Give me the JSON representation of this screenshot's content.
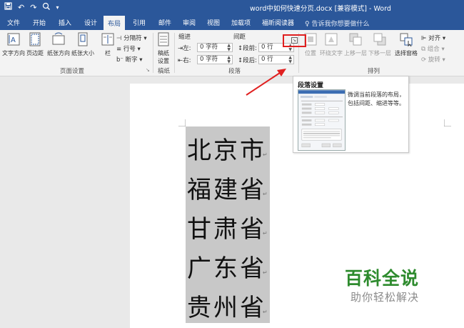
{
  "window": {
    "title": "word中如何快速分页.docx [兼容模式] - Word"
  },
  "tabs": [
    "文件",
    "开始",
    "插入",
    "设计",
    "布局",
    "引用",
    "邮件",
    "审阅",
    "视图",
    "加载项",
    "福昕阅读器"
  ],
  "active_tab": "布局",
  "tell_me": "告诉我你想要做什么",
  "ribbon": {
    "page_setup": {
      "text_direction": "文字方向",
      "margins": "页边距",
      "orientation": "纸张方向",
      "size": "纸张大小",
      "columns": "栏",
      "breaks": "分隔符",
      "line_numbers": "行号",
      "hyphenation": "断字",
      "group_label": "页面设置"
    },
    "draft": {
      "settings_l1": "稿纸",
      "settings_l2": "设置",
      "group_label": "稿纸"
    },
    "paragraph": {
      "indent_label": "缩进",
      "spacing_label": "间距",
      "left_label": "左:",
      "left_value": "0 字符",
      "right_label": "右:",
      "right_value": "0 字符",
      "before_label": "段前:",
      "before_value": "0 行",
      "after_label": "段后:",
      "after_value": "0 行",
      "group_label": "段落"
    },
    "arrange": {
      "position": "位置",
      "wrap_text": "环绕文字",
      "bring_forward": "上移一层",
      "send_backward": "下移一层",
      "selection_pane": "选择窗格",
      "align": "对齐",
      "group": "组合",
      "rotate": "旋转",
      "group_label": "排列"
    }
  },
  "tooltip": {
    "title": "段落设置",
    "description": "微调当前段落的布局，包括间距、缩进等等。"
  },
  "document": {
    "lines": [
      "北京市",
      "福建省",
      "甘肃省",
      "广东省",
      "贵州省"
    ]
  },
  "watermark": {
    "line1": "百科全说",
    "line2": "助你轻松解决"
  },
  "colors": {
    "title_bar": "#2b579a",
    "highlight_box": "#e02020",
    "watermark_green": "#2e8b2e"
  }
}
